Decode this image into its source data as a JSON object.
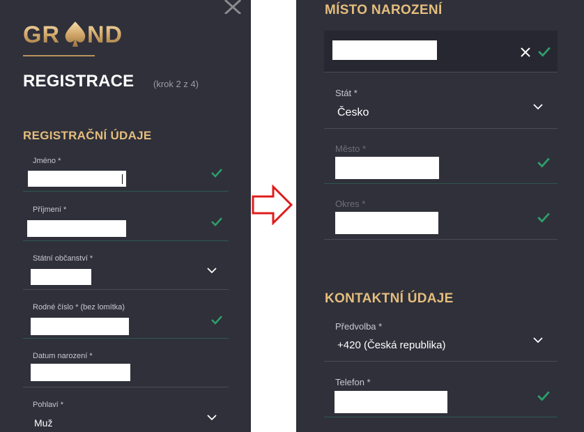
{
  "left": {
    "logo": "GRAND",
    "heading": "REGISTRACE",
    "step": "(krok 2 z 4)",
    "section_title": "REGISTRAČNÍ ÚDAJE",
    "fields": {
      "first_name": {
        "label": "Jméno *"
      },
      "last_name": {
        "label": "Příjmení *"
      },
      "nationality": {
        "label": "Státní občanství *"
      },
      "birth_number": {
        "label": "Rodné číslo * (bez lomítka)"
      },
      "birth_date": {
        "label": "Datum narození *"
      },
      "gender": {
        "label": "Pohlaví *",
        "value": "Muž"
      }
    }
  },
  "right": {
    "section_birthplace": "MÍSTO NAROZENÍ",
    "country": {
      "label": "Stát *",
      "value": "Česko"
    },
    "city": {
      "label": "Město *"
    },
    "district": {
      "label": "Okres *"
    },
    "section_contact": "KONTAKTNÍ ÚDAJE",
    "dial_code": {
      "label": "Předvolba *",
      "value": "+420 (Česká republika)"
    },
    "phone": {
      "label": "Telefon *"
    }
  },
  "colors": {
    "panel_bg": "#2f303a",
    "accent_gold": "#e5be7d",
    "check_green": "#2e9e6a",
    "arrow_red": "#e01c1c"
  },
  "icons": [
    "close-icon",
    "check-icon",
    "chevron-down-icon",
    "clear-x-icon",
    "right-arrow-icon"
  ]
}
